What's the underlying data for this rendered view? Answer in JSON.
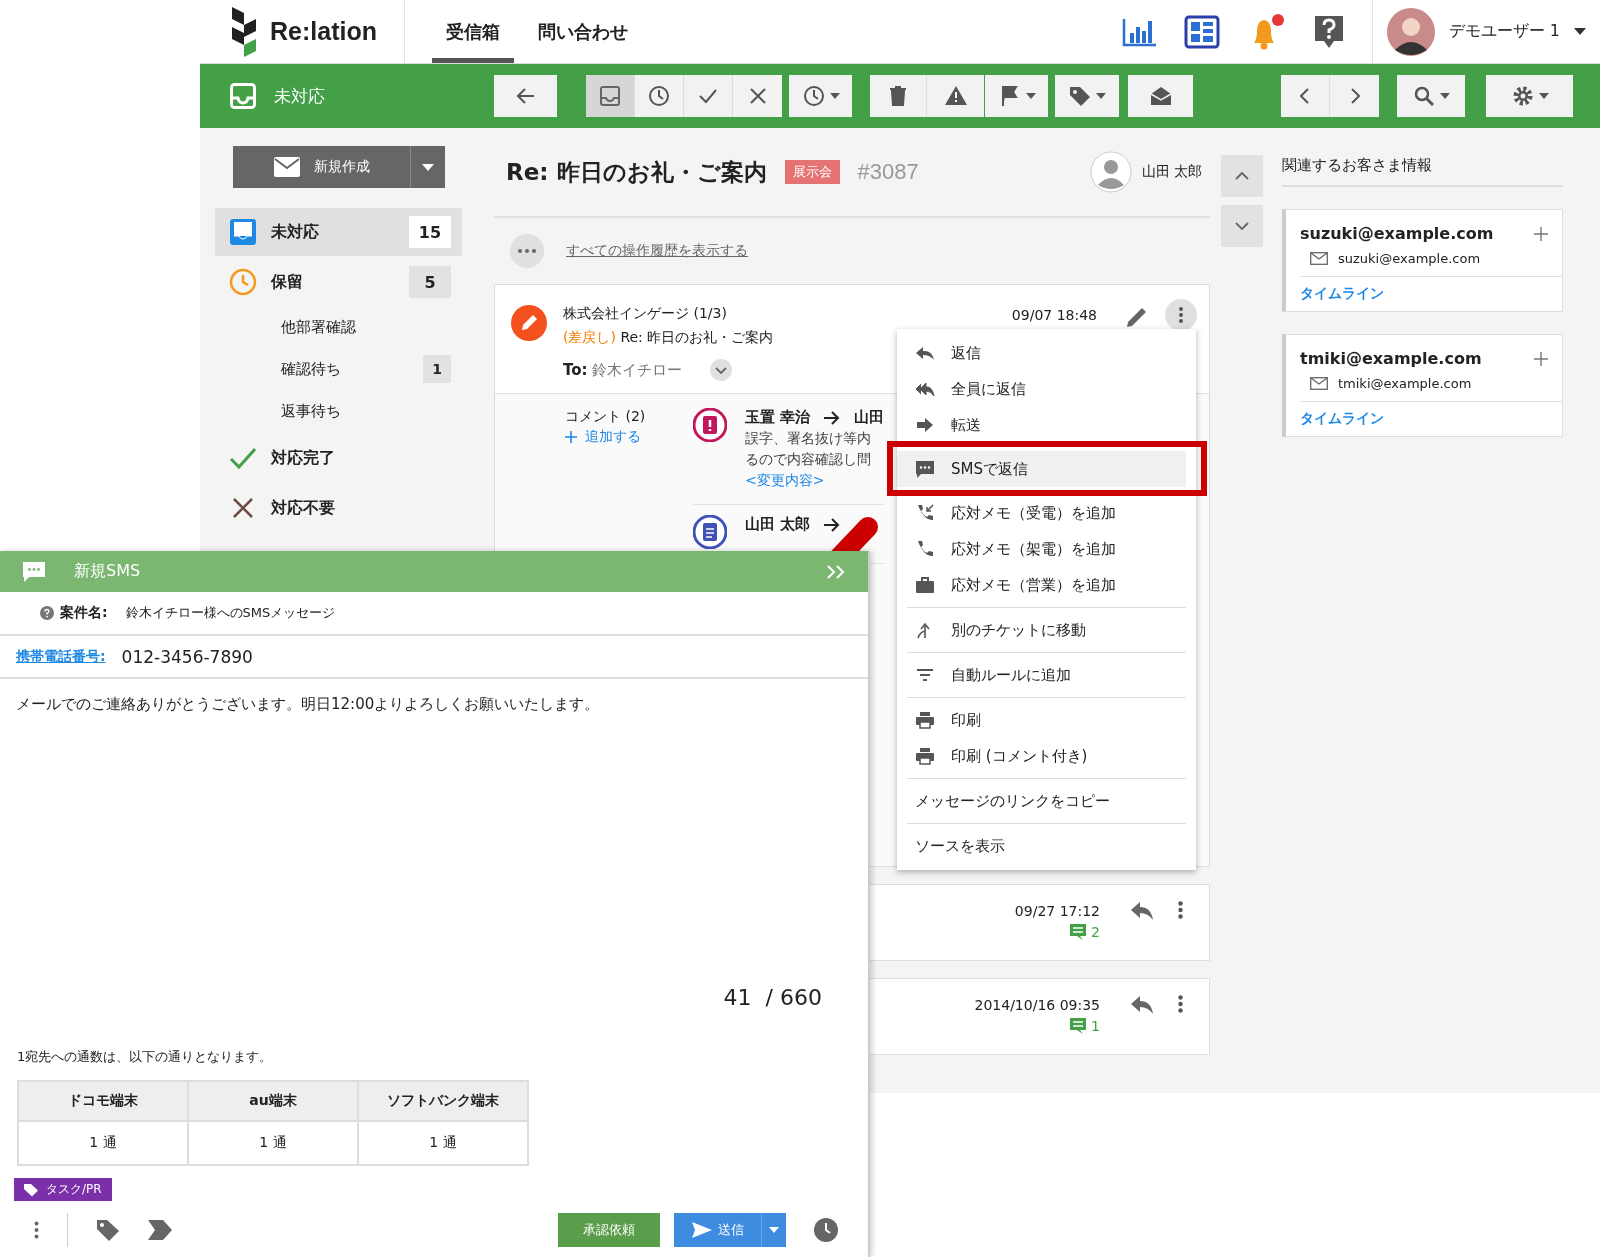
{
  "header": {
    "logo": "Re:lation",
    "tabs": [
      {
        "label": "受信箱",
        "selected": true
      },
      {
        "label": "問い合わせ",
        "selected": false
      }
    ],
    "has_notification": true,
    "user": "デモユーザー 1"
  },
  "toolbar": {
    "title": "未対応",
    "status_buttons": [
      {
        "selected": true
      },
      {
        "selected": false
      },
      {
        "selected": false
      },
      {
        "selected": false
      }
    ]
  },
  "sidebar": {
    "compose": "新規作成",
    "items": [
      {
        "kind": "open",
        "label": "未対応",
        "count": "15",
        "selected": true
      },
      {
        "kind": "hold",
        "label": "保留",
        "count": "5",
        "selected": false,
        "children": [
          {
            "label": "他部署確認",
            "selected": false
          },
          {
            "label": "確認待ち",
            "count": "1",
            "selected": false
          },
          {
            "label": "返事待ち",
            "selected": false
          }
        ]
      },
      {
        "kind": "done",
        "label": "対応完了",
        "selected": false
      },
      {
        "kind": "skip",
        "label": "対応不要",
        "selected": false
      }
    ]
  },
  "ticket": {
    "title": "Re: 昨日のお礼・ご案内",
    "tag": "展示会",
    "number": "#3087",
    "assignee": "山田 太郎",
    "history_link": "すべての操作履歴を表示する",
    "messages": [
      {
        "kind": "draft",
        "sender": "株式会社インゲージ (1/3)",
        "status": "(差戻し)",
        "subject": "Re: 昨日のお礼・ご案内",
        "to_label": "To:",
        "to": "鈴木イチロー",
        "date": "09/07 18:48",
        "comments_heading": "コメント (2)",
        "add_comment": "追加する",
        "comments": [
          {
            "kind": "alert",
            "from": "玉置 幸治",
            "to": "山田",
            "lines": [
              "誤字、署名抜け等内",
              "るので内容確認し問"
            ],
            "link": "<変更内容>"
          },
          {
            "kind": "note",
            "from": "山田 太郎"
          }
        ]
      },
      {
        "kind": "mail",
        "date": "09/27 17:12",
        "comment_count": "2"
      },
      {
        "kind": "mail",
        "date": "2014/10/16 09:35",
        "comment_count": "1"
      }
    ]
  },
  "customers": {
    "heading": "関連するお客さま情報",
    "cards": [
      {
        "name": "suzuki@example.com",
        "email": "suzuki@example.com",
        "link": "タイムライン"
      },
      {
        "name": "tmiki@example.com",
        "email": "tmiki@example.com",
        "link": "タイムライン"
      }
    ]
  },
  "context_menu": {
    "groups": [
      {
        "items": [
          {
            "kind": "reply",
            "label": "返信",
            "selected": false
          },
          {
            "kind": "reply_all",
            "label": "全員に返信",
            "selected": false
          },
          {
            "kind": "forward",
            "label": "転送",
            "selected": false
          },
          {
            "kind": "sms",
            "label": "SMSで返信",
            "selected": true
          },
          {
            "kind": "call_in",
            "label": "応対メモ（受電）を追加",
            "selected": false
          },
          {
            "kind": "call_out",
            "label": "応対メモ（架電）を追加",
            "selected": false
          },
          {
            "kind": "sales",
            "label": "応対メモ（営業）を追加",
            "selected": false
          }
        ]
      },
      {
        "items": [
          {
            "kind": "move",
            "label": "別のチケットに移動",
            "selected": false
          }
        ]
      },
      {
        "items": [
          {
            "kind": "filter",
            "label": "自動ルールに追加",
            "selected": false
          }
        ]
      },
      {
        "items": [
          {
            "kind": "print",
            "label": "印刷",
            "selected": false
          },
          {
            "kind": "print",
            "label": "印刷 (コメント付き)",
            "selected": false
          }
        ]
      },
      {
        "items": [
          {
            "kind": "plain",
            "label": "メッセージのリンクをコピー",
            "selected": false
          }
        ]
      },
      {
        "items": [
          {
            "kind": "plain",
            "label": "ソースを表示",
            "selected": false
          }
        ]
      }
    ]
  },
  "sms": {
    "title": "新規SMS",
    "subject_label": "案件名:",
    "subject": "鈴木イチロー様へのSMSメッセージ",
    "phone_label": "携帯電話番号:",
    "phone": "012-3456-7890",
    "body": "メールでのご連絡ありがとうございます。明日12:00よりよろしくお願いいたします。",
    "counter": "41  / 660",
    "note": "1宛先への通数は、以下の通りとなります。",
    "table": {
      "columns": [
        "ドコモ端末",
        "au端末",
        "ソフトバンク端末"
      ],
      "rows": [
        [
          "1 通",
          "1 通",
          "1 通"
        ]
      ]
    },
    "tag": {
      "label": "タスク/PR",
      "color": "#7b2fa8"
    },
    "approve": "承認依頼",
    "send": "送信"
  }
}
